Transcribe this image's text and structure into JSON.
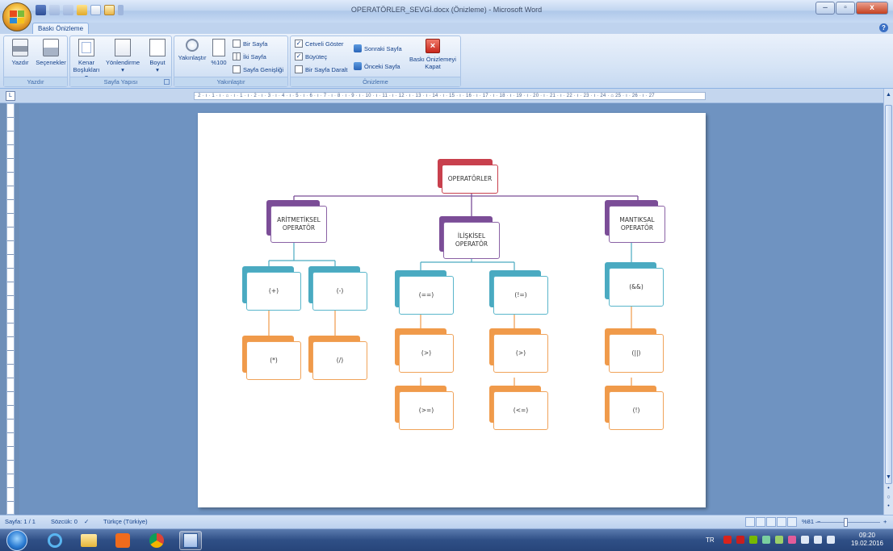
{
  "window": {
    "title": "OPERATÖRLER_SEVGİ.docx (Önizleme) - Microsoft Word",
    "controls": [
      "–",
      "▫",
      "x"
    ]
  },
  "ribbon": {
    "active_tab": "Baskı Önizleme",
    "groups": {
      "print": {
        "label": "Yazdır",
        "print_btn": "Yazdır",
        "options_btn": "Seçenekler"
      },
      "page_setup": {
        "label": "Sayfa Yapısı",
        "margins_line1": "Kenar",
        "margins_line2": "Boşlukları ▾",
        "orientation": "Yönlendirme",
        "orientation_arrow": "▾",
        "size": "Boyut",
        "size_arrow": "▾"
      },
      "zoom": {
        "label": "Yakınlaştır",
        "zoom_btn": "Yakınlaştır",
        "hundred_btn": "%100",
        "one_page": "Bir Sayfa",
        "two_pages": "İki Sayfa",
        "page_width": "Sayfa Genişliği"
      },
      "preview": {
        "label": "Önizleme",
        "show_ruler": "Cetveli Göster",
        "magnifier": "Büyüteç",
        "shrink_one_page": "Bir Sayfa Daralt",
        "next_page": "Sonraki Sayfa",
        "previous_page": "Önceki Sayfa",
        "close_preview_line1": "Baskı Önizlemeyi",
        "close_preview_line2": "Kapat"
      }
    }
  },
  "ruler": {
    "text": "· 2 · ı · 1 · ı · ⌂ · ı · 1 · ı · 2 · ı · 3 · ı · 4 · ı · 5 · ı · 6 · ı · 7 · ı · 8 · ı · 9 · ı · 10 · ı · 11 · ı · 12 · ı · 13 · ı · 14 · ı · 15 · ı · 16 · ı · 17 · ı · 18 · ı · 19 · ı · 20 · ı · 21 · ı · 22 · ı · 23 · ı · 24 · ⌂ 25 · ı · 26 · ı · 27",
    "toggle": "L"
  },
  "diagram": {
    "root": "OPERATÖRLER",
    "branches": [
      {
        "title": "ARİTMETİKSEL OPERATÖR",
        "children": [
          {
            "label": "(+)",
            "child": "(*)"
          },
          {
            "label": "(-)",
            "child": "(/)"
          }
        ]
      },
      {
        "title": "İLİŞKİSEL OPERATÖR",
        "children": [
          {
            "label": "(==)",
            "sub": [
              "(>)",
              "(>=)"
            ]
          },
          {
            "label": "(!=)",
            "sub": [
              "(>)",
              "(<=)"
            ]
          }
        ]
      },
      {
        "title": "MANTIKSAL OPERATÖR",
        "children": [
          {
            "label": "(&&)",
            "sub": [
              "(||)",
              "(!)"
            ]
          }
        ]
      }
    ]
  },
  "status": {
    "page": "Sayfa: 1 / 1",
    "words": "Sözcük: 0",
    "language": "Türkçe (Türkiye)",
    "zoom": "%81",
    "zoom_minus": "−",
    "zoom_plus": "+"
  },
  "taskbar": {
    "lang": "TR",
    "time": "09:20",
    "date": "19.02.2016"
  },
  "colors": {
    "root": "#c8404d",
    "category": "#7b4d97",
    "operator": "#4aaac1",
    "sub_operator": "#f09a4a",
    "connector": "#7b4d97"
  }
}
